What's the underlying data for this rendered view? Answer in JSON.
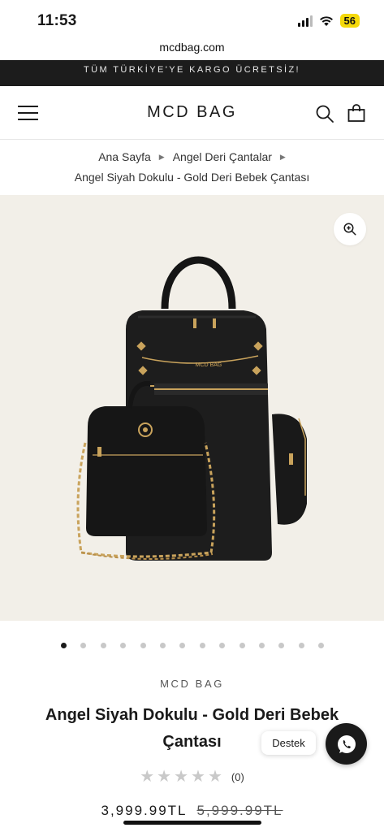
{
  "status_bar": {
    "time": "11:53",
    "battery": "56"
  },
  "browser": {
    "url": "mcdbag.com"
  },
  "announcement": {
    "text": "TÜM TÜRKİYE'YE KARGO ÜCRETSİZ!"
  },
  "header": {
    "logo": "MCD BAG",
    "icons": [
      "hamburger-menu-icon",
      "search-icon",
      "shopping-bag-icon"
    ]
  },
  "breadcrumb": {
    "items": [
      "Ana Sayfa",
      "Angel Deri Çantalar"
    ],
    "current": "Angel Siyah Dokulu - Gold Deri Bebek Çantası"
  },
  "media": {
    "zoom_icon": "zoom-in-icon",
    "bag_logo": "MCD BAG",
    "slide_count": 14,
    "active_slide": 0
  },
  "product": {
    "vendor": "MCD BAG",
    "title": "Angel Siyah Dokulu - Gold Deri Bebek Çantası",
    "rating": 0,
    "rating_max": 5,
    "review_count": "(0)",
    "price": "3,999.99TL",
    "compare_price": "5,999.99TL"
  },
  "support": {
    "label": "Destek",
    "icon": "whatsapp-icon"
  },
  "colors": {
    "announcement_bg": "#1c1c1c",
    "media_bg": "#f2efe8",
    "accent_gold": "#c9a35c"
  }
}
